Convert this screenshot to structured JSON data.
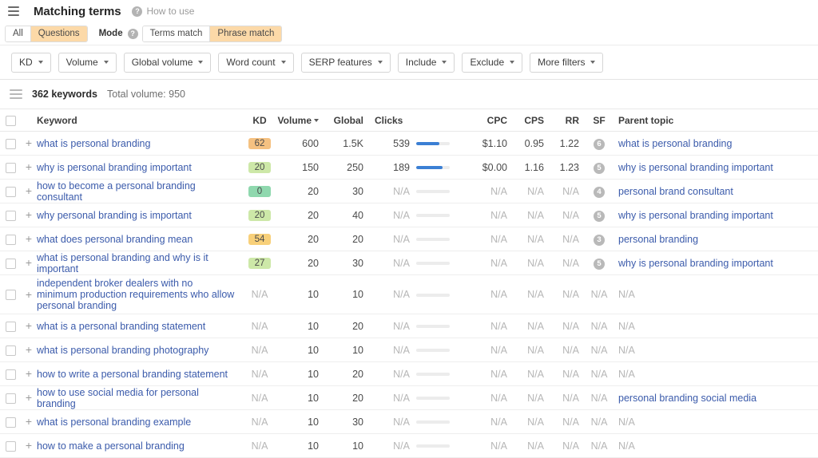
{
  "header": {
    "menu_icon": "hamburger-menu-icon",
    "title": "Matching terms",
    "help_icon": "help-circle-icon",
    "how_to_use": "How to use"
  },
  "segments": {
    "type_filter": {
      "options": [
        "All",
        "Questions"
      ],
      "active": "Questions"
    },
    "mode_label": "Mode",
    "mode_help_icon": "help-circle-icon",
    "mode_filter": {
      "options": [
        "Terms match",
        "Phrase match"
      ],
      "active": "Phrase match"
    }
  },
  "filters": [
    {
      "label": "KD"
    },
    {
      "label": "Volume"
    },
    {
      "label": "Global volume"
    },
    {
      "label": "Word count"
    },
    {
      "label": "SERP features"
    },
    {
      "label": "Include"
    },
    {
      "label": "Exclude"
    },
    {
      "label": "More filters"
    }
  ],
  "summary": {
    "list_icon": "list-view-icon",
    "keyword_count": "362 keywords",
    "total_volume": "Total volume: 950"
  },
  "table": {
    "columns": {
      "keyword": "Keyword",
      "kd": "KD",
      "volume": "Volume",
      "global": "Global",
      "clicks": "Clicks",
      "cpc": "CPC",
      "cps": "CPS",
      "rr": "RR",
      "sf": "SF",
      "parent_topic": "Parent topic"
    },
    "sorted_column": "volume",
    "rows": [
      {
        "keyword": "what is personal branding",
        "kd": "62",
        "kd_color": "#f5c181",
        "volume": "600",
        "global": "1.5K",
        "clicks": "539",
        "bar_pct": 68,
        "bar_active": true,
        "cpc": "$1.10",
        "cps": "0.95",
        "rr": "1.22",
        "sf": "6",
        "parent_topic": "what is personal branding",
        "parent_is_link": true
      },
      {
        "keyword": "why is personal branding important",
        "kd": "20",
        "kd_color": "#cde8a8",
        "volume": "150",
        "global": "250",
        "clicks": "189",
        "bar_pct": 78,
        "bar_active": true,
        "cpc": "$0.00",
        "cps": "1.16",
        "rr": "1.23",
        "sf": "5",
        "parent_topic": "why is personal branding important",
        "parent_is_link": true
      },
      {
        "keyword": "how to become a personal branding consultant",
        "kd": "0",
        "kd_color": "#8fd8ae",
        "volume": "20",
        "global": "30",
        "clicks": "N/A",
        "bar_pct": 0,
        "bar_active": false,
        "cpc": "N/A",
        "cps": "N/A",
        "rr": "N/A",
        "sf": "4",
        "parent_topic": "personal brand consultant",
        "parent_is_link": true
      },
      {
        "keyword": "why personal branding is important",
        "kd": "20",
        "kd_color": "#cde8a8",
        "volume": "20",
        "global": "40",
        "clicks": "N/A",
        "bar_pct": 0,
        "bar_active": false,
        "cpc": "N/A",
        "cps": "N/A",
        "rr": "N/A",
        "sf": "5",
        "parent_topic": "why is personal branding important",
        "parent_is_link": true
      },
      {
        "keyword": "what does personal branding mean",
        "kd": "54",
        "kd_color": "#f8d07a",
        "volume": "20",
        "global": "20",
        "clicks": "N/A",
        "bar_pct": 0,
        "bar_active": false,
        "cpc": "N/A",
        "cps": "N/A",
        "rr": "N/A",
        "sf": "3",
        "parent_topic": "personal branding",
        "parent_is_link": true
      },
      {
        "keyword": "what is personal branding and why is it important",
        "kd": "27",
        "kd_color": "#cde8a8",
        "volume": "20",
        "global": "30",
        "clicks": "N/A",
        "bar_pct": 0,
        "bar_active": false,
        "cpc": "N/A",
        "cps": "N/A",
        "rr": "N/A",
        "sf": "5",
        "parent_topic": "why is personal branding important",
        "parent_is_link": true
      },
      {
        "keyword": "independent broker dealers with no minimum production requirements who allow personal branding",
        "kd": "N/A",
        "kd_color": "",
        "volume": "10",
        "global": "10",
        "clicks": "N/A",
        "bar_pct": 0,
        "bar_active": false,
        "cpc": "N/A",
        "cps": "N/A",
        "rr": "N/A",
        "sf": "N/A",
        "parent_topic": "N/A",
        "parent_is_link": false,
        "tall": true
      },
      {
        "keyword": "what is a personal branding statement",
        "kd": "N/A",
        "kd_color": "",
        "volume": "10",
        "global": "20",
        "clicks": "N/A",
        "bar_pct": 0,
        "bar_active": false,
        "cpc": "N/A",
        "cps": "N/A",
        "rr": "N/A",
        "sf": "N/A",
        "parent_topic": "N/A",
        "parent_is_link": false
      },
      {
        "keyword": "what is personal branding photography",
        "kd": "N/A",
        "kd_color": "",
        "volume": "10",
        "global": "10",
        "clicks": "N/A",
        "bar_pct": 0,
        "bar_active": false,
        "cpc": "N/A",
        "cps": "N/A",
        "rr": "N/A",
        "sf": "N/A",
        "parent_topic": "N/A",
        "parent_is_link": false
      },
      {
        "keyword": "how to write a personal branding statement",
        "kd": "N/A",
        "kd_color": "",
        "volume": "10",
        "global": "20",
        "clicks": "N/A",
        "bar_pct": 0,
        "bar_active": false,
        "cpc": "N/A",
        "cps": "N/A",
        "rr": "N/A",
        "sf": "N/A",
        "parent_topic": "N/A",
        "parent_is_link": false
      },
      {
        "keyword": "how to use social media for personal branding",
        "kd": "N/A",
        "kd_color": "",
        "volume": "10",
        "global": "20",
        "clicks": "N/A",
        "bar_pct": 0,
        "bar_active": false,
        "cpc": "N/A",
        "cps": "N/A",
        "rr": "N/A",
        "sf": "N/A",
        "parent_topic": "personal branding social media",
        "parent_is_link": true
      },
      {
        "keyword": "what is personal branding example",
        "kd": "N/A",
        "kd_color": "",
        "volume": "10",
        "global": "30",
        "clicks": "N/A",
        "bar_pct": 0,
        "bar_active": false,
        "cpc": "N/A",
        "cps": "N/A",
        "rr": "N/A",
        "sf": "N/A",
        "parent_topic": "N/A",
        "parent_is_link": false
      },
      {
        "keyword": "how to make a personal branding",
        "kd": "N/A",
        "kd_color": "",
        "volume": "10",
        "global": "10",
        "clicks": "N/A",
        "bar_pct": 0,
        "bar_active": false,
        "cpc": "N/A",
        "cps": "N/A",
        "rr": "N/A",
        "sf": "N/A",
        "parent_topic": "N/A",
        "parent_is_link": false
      }
    ]
  },
  "colors": {
    "accent_orange": "#fcd9a8",
    "link_blue": "#3b5bab",
    "bar_blue": "#3b7fd4"
  }
}
